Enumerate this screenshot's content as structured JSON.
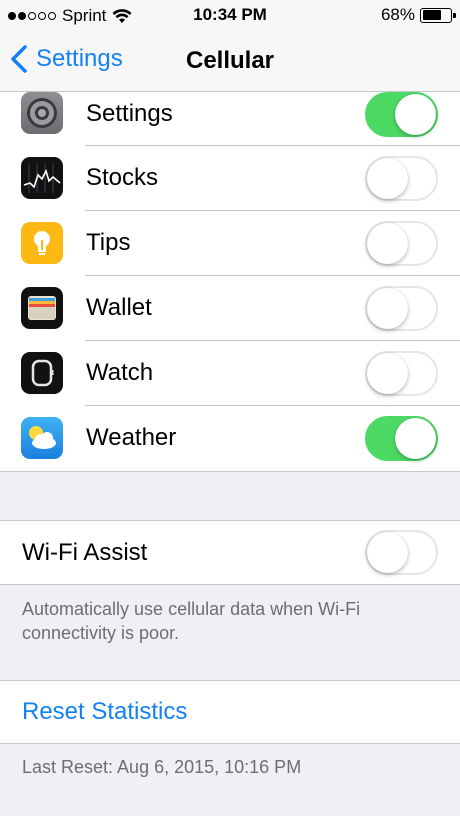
{
  "status_bar": {
    "carrier": "Sprint",
    "signal_bars_filled": 2,
    "signal_bars_total": 5,
    "time": "10:34 PM",
    "battery_percent": "68%",
    "battery_level": 0.68
  },
  "nav": {
    "back_label": "Settings",
    "title": "Cellular"
  },
  "apps": [
    {
      "label": "Settings",
      "icon": "settings-app-icon",
      "enabled": true
    },
    {
      "label": "Stocks",
      "icon": "stocks-app-icon",
      "enabled": false
    },
    {
      "label": "Tips",
      "icon": "tips-app-icon",
      "enabled": false
    },
    {
      "label": "Wallet",
      "icon": "wallet-app-icon",
      "enabled": false
    },
    {
      "label": "Watch",
      "icon": "watch-app-icon",
      "enabled": false
    },
    {
      "label": "Weather",
      "icon": "weather-app-icon",
      "enabled": true
    }
  ],
  "wifi_assist": {
    "label": "Wi-Fi Assist",
    "enabled": false,
    "footer": "Automatically use cellular data when Wi-Fi connectivity is poor."
  },
  "reset": {
    "label": "Reset Statistics",
    "last_reset": "Last Reset: Aug 6, 2015, 10:16 PM"
  },
  "colors": {
    "accent": "#1480f5",
    "toggle_on": "#4cd964",
    "background": "#efeff4"
  }
}
